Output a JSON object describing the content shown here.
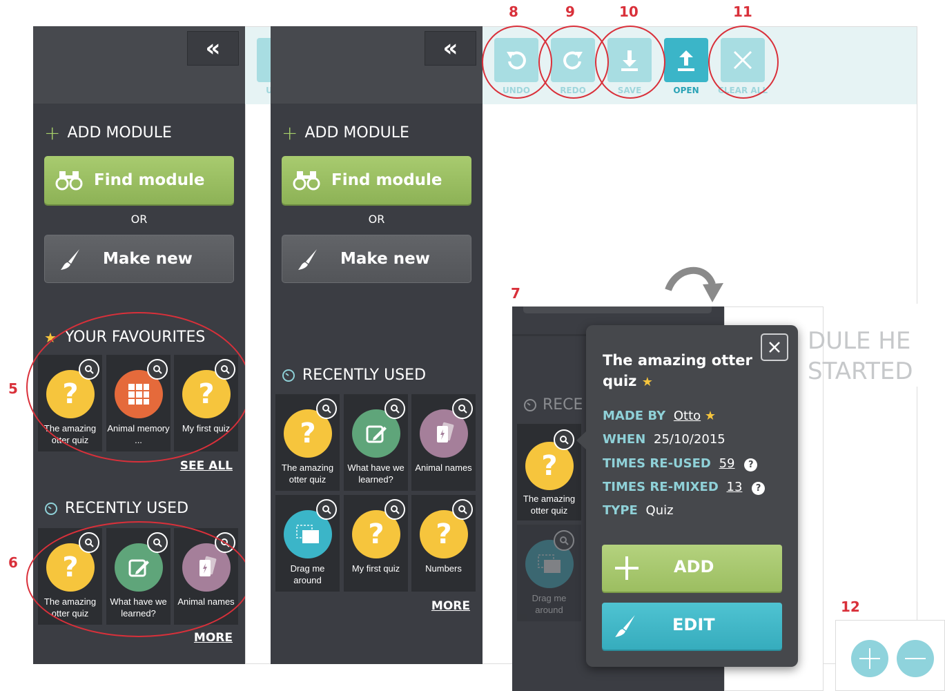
{
  "annotations": {
    "n5": "5",
    "n6": "6",
    "n7": "7",
    "n8": "8",
    "n9": "9",
    "n10": "10",
    "n11": "11",
    "n12": "12"
  },
  "left_panel": {
    "collapse": "«",
    "add_module": "ADD MODULE",
    "find_module": "Find module",
    "or": "OR",
    "make_new": "Make new",
    "favourites_title": "YOUR FAVOURITES",
    "favourites": [
      {
        "label": "The amazing otter quiz",
        "icon": "question-icon",
        "color": "#f6c53d"
      },
      {
        "label": "Animal memory ...",
        "icon": "memory-grid-icon",
        "color": "#e56a3b"
      },
      {
        "label": "My first quiz",
        "icon": "question-icon",
        "color": "#f6c53d"
      }
    ],
    "see_all": "SEE ALL",
    "recent_title": "RECENTLY USED",
    "recent": [
      {
        "label": "The amazing otter quiz",
        "icon": "question-icon",
        "color": "#f6c53d"
      },
      {
        "label": "What have we learned?",
        "icon": "pencil-edit-icon",
        "color": "#5fa57a"
      },
      {
        "label": "Animal names",
        "icon": "cards-icon",
        "color": "#a57f9a"
      }
    ],
    "more": "MORE"
  },
  "middle_panel": {
    "collapse": "«",
    "add_module": "ADD MODULE",
    "find_module": "Find module",
    "or": "OR",
    "make_new": "Make new",
    "recent_title": "RECENTLY USED",
    "recent": [
      {
        "label": "The amazing otter quiz",
        "icon": "question-icon",
        "color": "#f6c53d"
      },
      {
        "label": "What have we learned?",
        "icon": "pencil-edit-icon",
        "color": "#5fa57a"
      },
      {
        "label": "Animal names",
        "icon": "cards-icon",
        "color": "#a57f9a"
      },
      {
        "label": "Drag me around",
        "icon": "drag-icon",
        "color": "#3bb5c8"
      },
      {
        "label": "My first quiz",
        "icon": "question-icon",
        "color": "#f6c53d"
      },
      {
        "label": "Numbers",
        "icon": "question-icon",
        "color": "#f6c53d"
      }
    ],
    "more": "MORE",
    "partial_toolbar_label": "U"
  },
  "toolbar": {
    "undo": "UNDO",
    "redo": "REDO",
    "save": "SAVE",
    "open": "OPEN",
    "clear_all": "CLEAR ALL"
  },
  "detail": {
    "bg_recent_title": "RECE",
    "bg_tile1": "The amazing otter quiz",
    "bg_tile2": "Drag me around",
    "canvas_text1": "DULE HE",
    "canvas_text2": "STARTED",
    "title_line1": "The amazing otter",
    "title_line2": "quiz",
    "made_by_k": "MADE BY",
    "made_by_v": "Otto",
    "when_k": "WHEN",
    "when_v": "25/10/2015",
    "reused_k": "TIMES RE-USED",
    "reused_v": "59",
    "remixed_k": "TIMES RE-MIXED",
    "remixed_v": "13",
    "type_k": "TYPE",
    "type_v": "Quiz",
    "add": "ADD",
    "edit": "EDIT"
  },
  "colors": {
    "panel": "#3b3d43",
    "accent_green": "#a8cb6f",
    "accent_teal": "#3bb5c8",
    "annotation_red": "#d9303a"
  }
}
